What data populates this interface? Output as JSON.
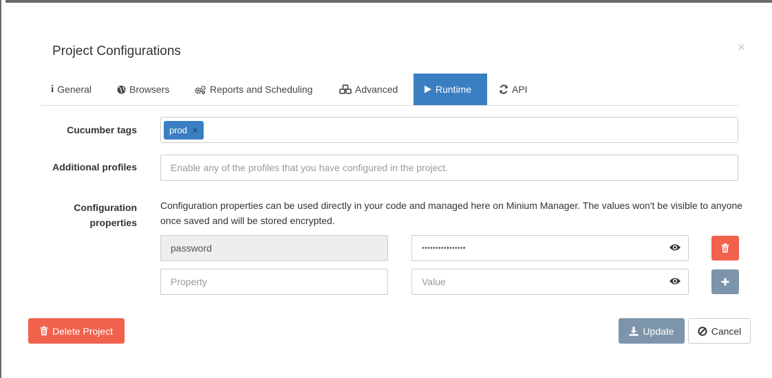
{
  "modal": {
    "title": "Project Configurations",
    "close_symbol": "×"
  },
  "tabs": [
    {
      "label": "General",
      "icon": "info-icon",
      "active": false
    },
    {
      "label": "Browsers",
      "icon": "globe-icon",
      "active": false
    },
    {
      "label": "Reports and Scheduling",
      "icon": "gears-icon",
      "active": false
    },
    {
      "label": "Advanced",
      "icon": "cubes-icon",
      "active": false
    },
    {
      "label": "Runtime",
      "icon": "play-icon",
      "active": true
    },
    {
      "label": "API",
      "icon": "refresh-icon",
      "active": false
    }
  ],
  "form": {
    "cucumber_tags": {
      "label": "Cucumber tags",
      "tags": [
        {
          "text": "prod",
          "remove_symbol": "×"
        }
      ]
    },
    "additional_profiles": {
      "label": "Additional profiles",
      "placeholder": "Enable any of the profiles that you have configured in the project."
    },
    "configuration_properties": {
      "label_line1": "Configuration",
      "label_line2": "properties",
      "help_text": "Configuration properties can be used directly in your code and managed here on Minium Manager. The values won't be visible to anyone once saved and will be stored encrypted.",
      "rows": [
        {
          "property": "password",
          "value_masked": "••••••••••••••••"
        }
      ],
      "new_row": {
        "property_placeholder": "Property",
        "value_placeholder": "Value"
      }
    }
  },
  "footer": {
    "delete_label": "Delete Project",
    "update_label": "Update",
    "cancel_label": "Cancel"
  },
  "colors": {
    "primary": "#3a7fc1",
    "danger": "#f0624c",
    "muted_button": "#7c95aa"
  }
}
